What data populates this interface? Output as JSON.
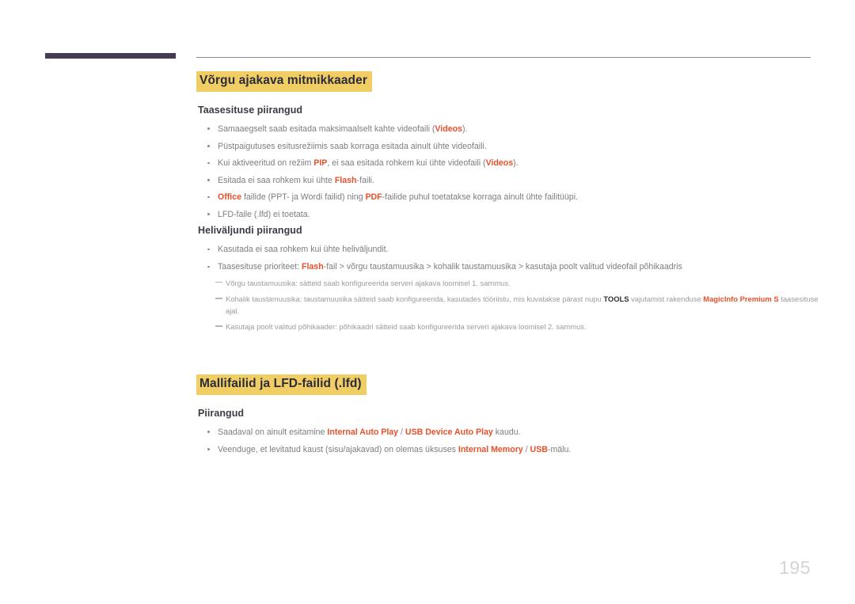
{
  "page": {
    "number": "195",
    "language": "et"
  },
  "colors": {
    "highlight": "#f0ce63",
    "keyword": "#e8502a",
    "corner_bar": "#453b52",
    "body_text": "#7c7d80",
    "page_number": "#d3d4d6"
  },
  "sections": [
    {
      "heading": "Võrgu ajakava mitmikkaader",
      "groups": [
        {
          "subheading": "Taasesituse piirangud",
          "bullets": [
            {
              "parts": [
                {
                  "t": "Samaaegselt saab esitada maksimaalselt kahte videofaili (",
                  "s": "plain"
                },
                {
                  "t": "Videos",
                  "s": "kw"
                },
                {
                  "t": ").",
                  "s": "plain"
                }
              ]
            },
            {
              "parts": [
                {
                  "t": "Püstpaigutuses esitusrežiimis saab korraga esitada ainult ühte videofaili.",
                  "s": "plain"
                }
              ]
            },
            {
              "parts": [
                {
                  "t": "Kui aktiveeritud on režiim ",
                  "s": "plain"
                },
                {
                  "t": "PIP",
                  "s": "kw"
                },
                {
                  "t": ", ei saa esitada rohkem kui ühte videofaili (",
                  "s": "plain"
                },
                {
                  "t": "Videos",
                  "s": "kw"
                },
                {
                  "t": ").",
                  "s": "plain"
                }
              ]
            },
            {
              "parts": [
                {
                  "t": "Esitada ei saa rohkem kui ühte ",
                  "s": "plain"
                },
                {
                  "t": "Flash",
                  "s": "kw"
                },
                {
                  "t": "-faili.",
                  "s": "plain"
                }
              ]
            },
            {
              "parts": [
                {
                  "t": "Office",
                  "s": "kw"
                },
                {
                  "t": " failide (PPT- ja Wordi failid) ning ",
                  "s": "plain"
                },
                {
                  "t": "PDF",
                  "s": "kw"
                },
                {
                  "t": "-failide puhul toetatakse korraga ainult ühte failitüüpi.",
                  "s": "plain"
                }
              ]
            },
            {
              "parts": [
                {
                  "t": "LFD-faile (.lfd) ei toetata.",
                  "s": "plain"
                }
              ]
            }
          ],
          "dashes": []
        },
        {
          "subheading": "Heliväljundi piirangud",
          "bullets": [
            {
              "parts": [
                {
                  "t": "Kasutada ei saa rohkem kui ühte heliväljundit.",
                  "s": "plain"
                }
              ]
            },
            {
              "parts": [
                {
                  "t": "Taasesituse prioriteet: ",
                  "s": "plain"
                },
                {
                  "t": "Flash",
                  "s": "kw"
                },
                {
                  "t": "-fail > võrgu taustamuusika > kohalik taustamuusika > kasutaja poolt valitud videofail põhikaadris",
                  "s": "plain"
                }
              ]
            }
          ],
          "dashes": [
            {
              "parts": [
                {
                  "t": "Võrgu taustamuusika: sätteid saab konfigureerida serveri ajakava loomisel 1. sammus.",
                  "s": "plain"
                }
              ]
            },
            {
              "parts": [
                {
                  "t": "Kohalik taustamuusika: taustamuusika sätteid saab konfigureerida, kasutades tööriistu, mis kuvatakse pärast nupu ",
                  "s": "plain"
                },
                {
                  "t": "TOOLS",
                  "s": "kw-dark"
                },
                {
                  "t": " vajutamist rakenduse ",
                  "s": "plain"
                },
                {
                  "t": "MagicInfo Premium S",
                  "s": "kw"
                },
                {
                  "t": " taasesituse ajal.",
                  "s": "plain"
                }
              ]
            },
            {
              "parts": [
                {
                  "t": "Kasutaja poolt valitud põhikaader: põhikaadri sätteid saab konfigureerida serveri ajakava loomisel 2. sammus.",
                  "s": "plain"
                }
              ]
            }
          ]
        }
      ]
    },
    {
      "heading": "Mallifailid ja LFD-failid (.lfd)",
      "groups": [
        {
          "subheading": "Piirangud",
          "bullets": [
            {
              "parts": [
                {
                  "t": "Saadaval on ainult esitamine ",
                  "s": "plain"
                },
                {
                  "t": "Internal Auto Play",
                  "s": "kw"
                },
                {
                  "t": " / ",
                  "s": "sep"
                },
                {
                  "t": "USB Device Auto Play",
                  "s": "kw"
                },
                {
                  "t": " kaudu.",
                  "s": "plain"
                }
              ]
            },
            {
              "parts": [
                {
                  "t": "Veenduge, et levitatud kaust (sisu/ajakavad) on olemas üksuses ",
                  "s": "plain"
                },
                {
                  "t": "Internal Memory",
                  "s": "kw"
                },
                {
                  "t": " / ",
                  "s": "sep"
                },
                {
                  "t": "USB",
                  "s": "kw"
                },
                {
                  "t": "-mälu.",
                  "s": "plain"
                }
              ]
            }
          ],
          "dashes": []
        }
      ]
    }
  ]
}
